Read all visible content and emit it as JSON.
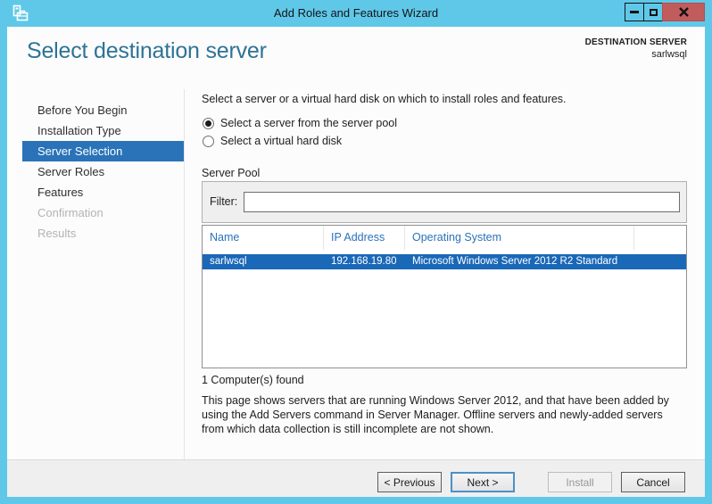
{
  "window": {
    "title": "Add Roles and Features Wizard",
    "icons": {
      "app": "roles-wizard-icon",
      "minimize": "minimize-icon",
      "maximize": "maximize-icon",
      "close": "close-icon"
    }
  },
  "header": {
    "page_title": "Select destination server",
    "destination": {
      "label": "DESTINATION SERVER",
      "server": "sarlwsql"
    }
  },
  "sidebar": {
    "items": [
      {
        "label": "Before You Begin",
        "state": "normal"
      },
      {
        "label": "Installation Type",
        "state": "normal"
      },
      {
        "label": "Server Selection",
        "state": "selected"
      },
      {
        "label": "Server Roles",
        "state": "normal"
      },
      {
        "label": "Features",
        "state": "normal"
      },
      {
        "label": "Confirmation",
        "state": "disabled"
      },
      {
        "label": "Results",
        "state": "disabled"
      }
    ]
  },
  "main": {
    "intro": "Select a server or a virtual hard disk on which to install roles and features.",
    "radios": [
      {
        "label": "Select a server from the server pool",
        "selected": true
      },
      {
        "label": "Select a virtual hard disk",
        "selected": false
      }
    ],
    "server_pool": {
      "title": "Server Pool",
      "filter": {
        "label": "Filter:",
        "value": ""
      },
      "table": {
        "columns": [
          "Name",
          "IP Address",
          "Operating System"
        ],
        "rows": [
          [
            "sarlwsql",
            "192.168.19.80",
            "Microsoft Windows Server 2012 R2 Standard"
          ]
        ],
        "selected_row": 0
      },
      "found_text": "1 Computer(s) found"
    },
    "description": "This page shows servers that are running Windows Server 2012, and that have been added by using the Add Servers command in Server Manager. Offline servers and newly-added servers from which data collection is still incomplete are not shown."
  },
  "footer": {
    "buttons": [
      {
        "label": "< Previous",
        "enabled": true
      },
      {
        "label": "Next >",
        "enabled": true,
        "focused": true
      },
      {
        "label": "Install",
        "enabled": false
      },
      {
        "label": "Cancel",
        "enabled": true
      }
    ]
  },
  "colors": {
    "titlebar": "#5FC8E9",
    "close_button": "#C25B5B",
    "sidebar_selected": "#2A73B8",
    "row_selected": "#1A68B8",
    "table_header_text": "#2A72B8",
    "page_title_text": "#2E7396",
    "footer_bg": "#EFEFEF"
  }
}
